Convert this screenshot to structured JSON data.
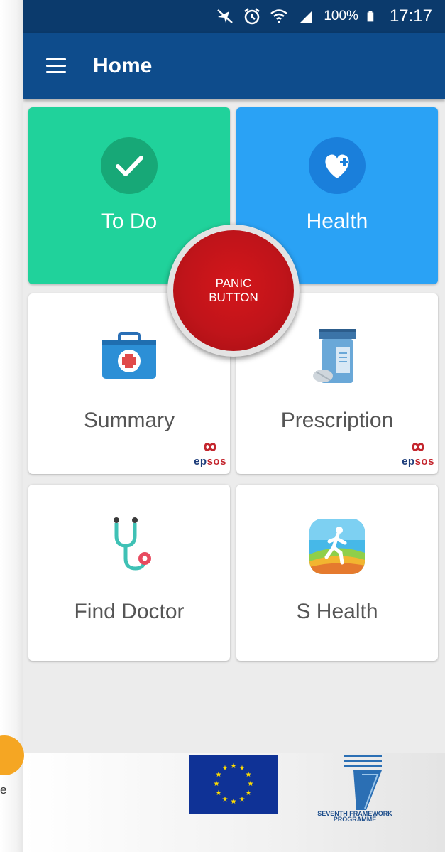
{
  "status_bar": {
    "battery_percent": "100%",
    "time": "17:17",
    "icons": [
      "mute-icon",
      "alarm-icon",
      "wifi-icon",
      "signal-icon",
      "battery-icon"
    ]
  },
  "app_bar": {
    "title": "Home",
    "menu_icon": "hamburger-menu-icon"
  },
  "tiles": {
    "todo": {
      "label": "To Do",
      "color": "#20d29b",
      "icon": "checkmark-icon"
    },
    "health": {
      "label": "Health",
      "color": "#2aa2f5",
      "icon": "heart-plus-icon"
    },
    "summary": {
      "label": "Summary",
      "icon": "medical-kit-icon",
      "badge": "epsos"
    },
    "prescription": {
      "label": "Prescription",
      "icon": "pill-bottle-icon",
      "badge": "epsos"
    },
    "find_doctor": {
      "label": "Find Doctor",
      "icon": "stethoscope-icon"
    },
    "s_health": {
      "label": "S Health",
      "icon": "runner-icon"
    }
  },
  "panic_button": {
    "line1": "PANIC",
    "line2": "BUTTON",
    "color": "#c8151b"
  },
  "footer": {
    "eu_flag": "eu-flag-logo",
    "fp7_line1": "SEVENTH FRAMEWORK",
    "fp7_line2": "PROGRAMME"
  },
  "edge_text": "e"
}
